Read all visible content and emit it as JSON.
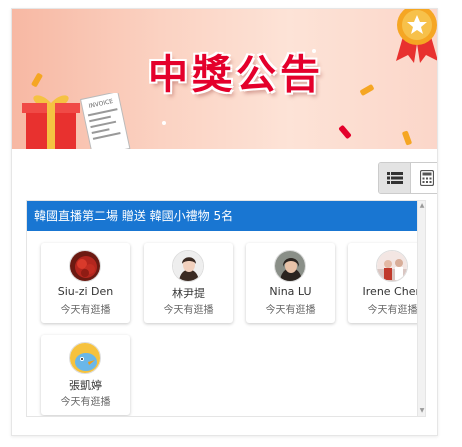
{
  "banner": {
    "title": "中獎公告",
    "receipt_text": "INVOICE"
  },
  "view_toggle": {
    "active": "list",
    "options": [
      "list-view",
      "grid-view"
    ]
  },
  "list": {
    "header": "韓國直播第二場 贈送 韓國小禮物 5名",
    "winners": [
      {
        "name": "Siu-zi Den",
        "status": "今天有逛播",
        "avatar": "red-plant-photo"
      },
      {
        "name": "林尹提",
        "status": "今天有逛播",
        "avatar": "woman-portrait-photo"
      },
      {
        "name": "Nina LU",
        "status": "今天有逛播",
        "avatar": "woman-portrait-photo"
      },
      {
        "name": "Irene Chen",
        "status": "今天有逛播",
        "avatar": "people-photo"
      },
      {
        "name": "張凱婷",
        "status": "今天有逛播",
        "avatar": "cartoon-bird-photo"
      }
    ]
  },
  "colors": {
    "accent": "#1976d2",
    "title_red": "#e4002b",
    "banner_bg": "#fbd2c2"
  }
}
